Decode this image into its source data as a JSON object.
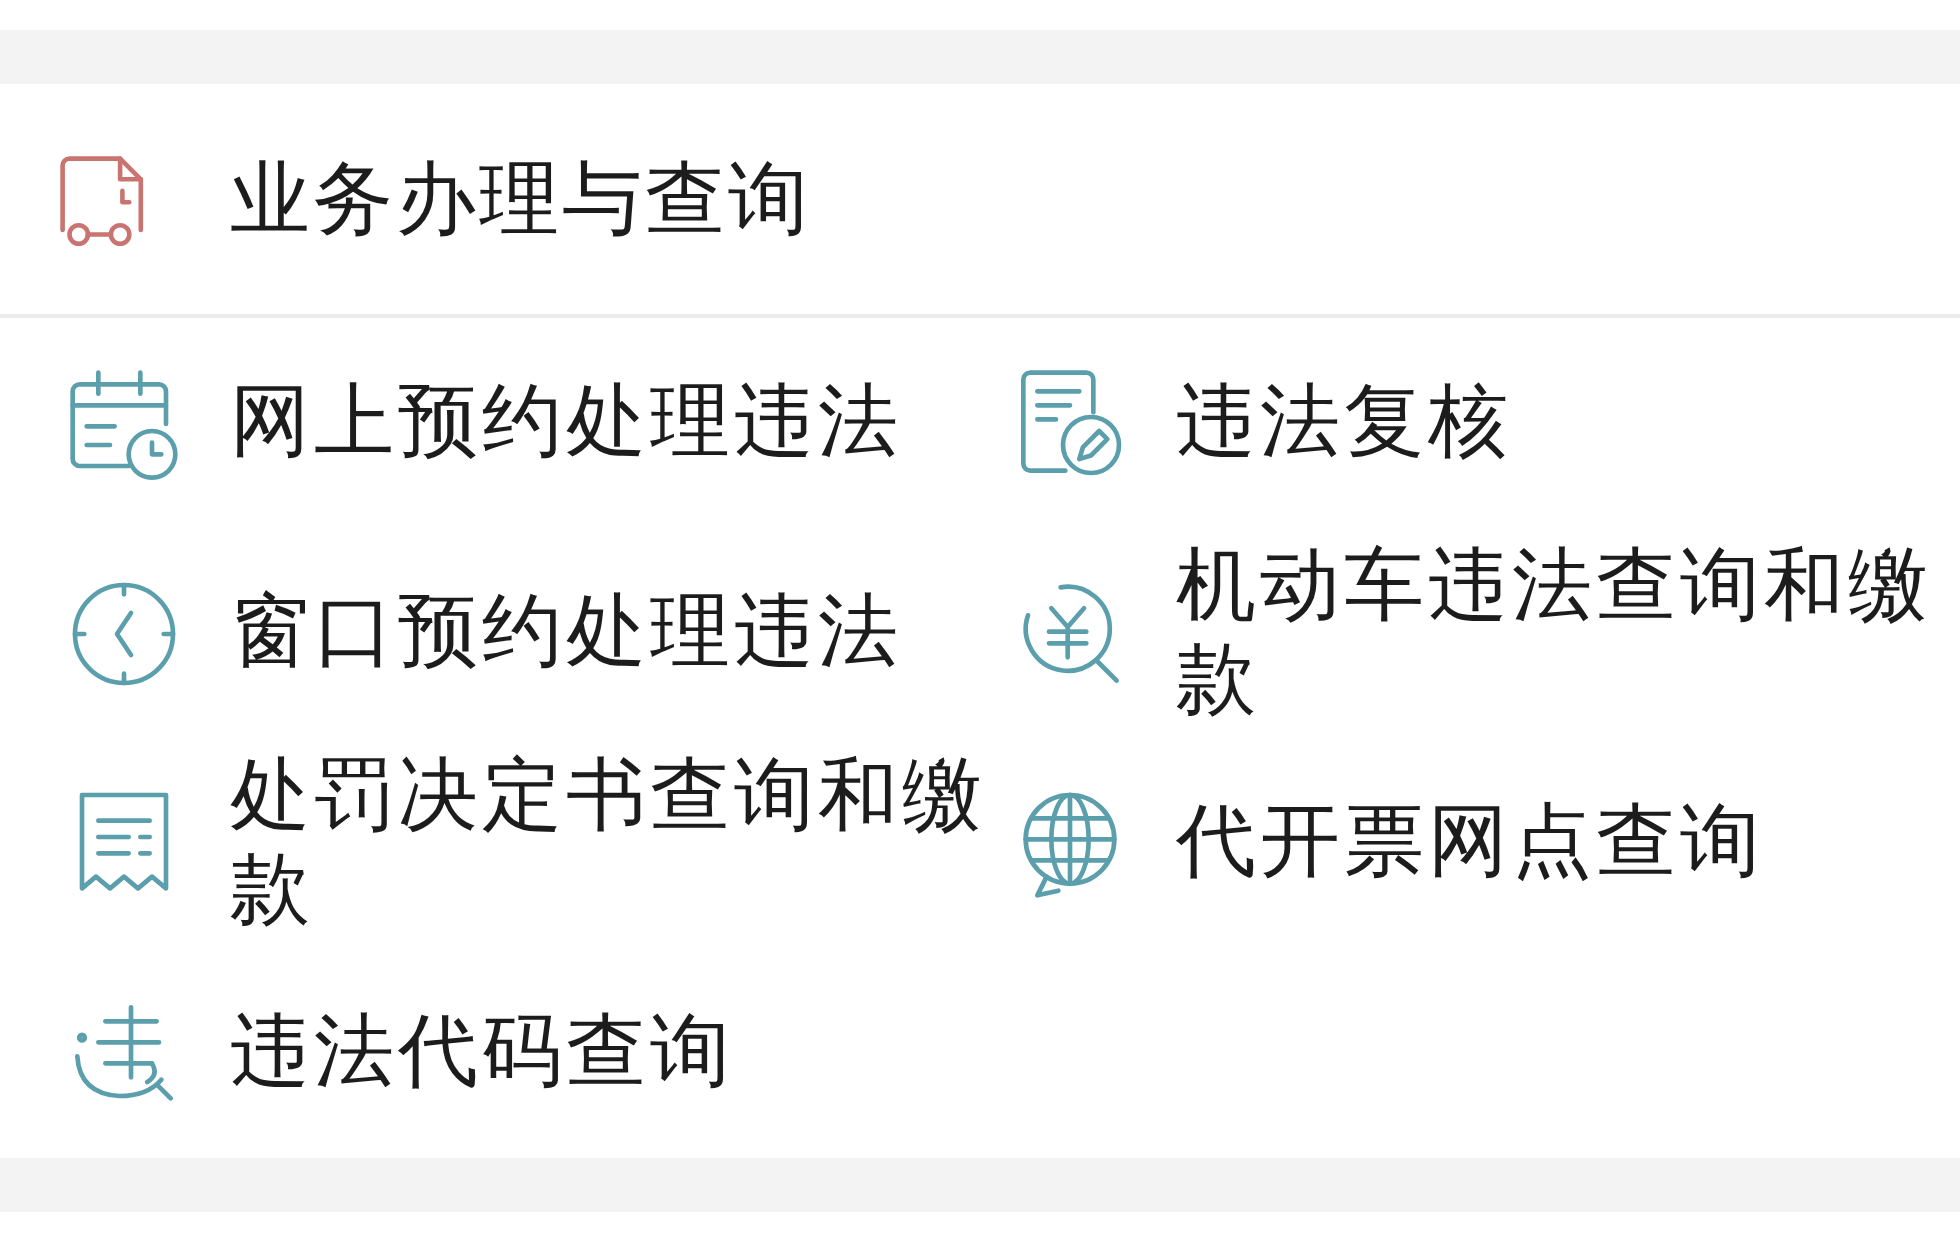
{
  "section": {
    "title": "业务办理与查询",
    "items": [
      {
        "label": "网上预约处理违法",
        "kind": "calendar"
      },
      {
        "label": "违法复核",
        "kind": "review"
      },
      {
        "label": "窗口预约处理违法",
        "kind": "clock"
      },
      {
        "label": "机动车违法查询和缴款",
        "kind": "fine"
      },
      {
        "label": "处罚决定书查询和缴款",
        "kind": "receipt"
      },
      {
        "label": "代开票网点查询",
        "kind": "outlet"
      },
      {
        "label": "违法代码查询",
        "kind": "code"
      }
    ]
  }
}
